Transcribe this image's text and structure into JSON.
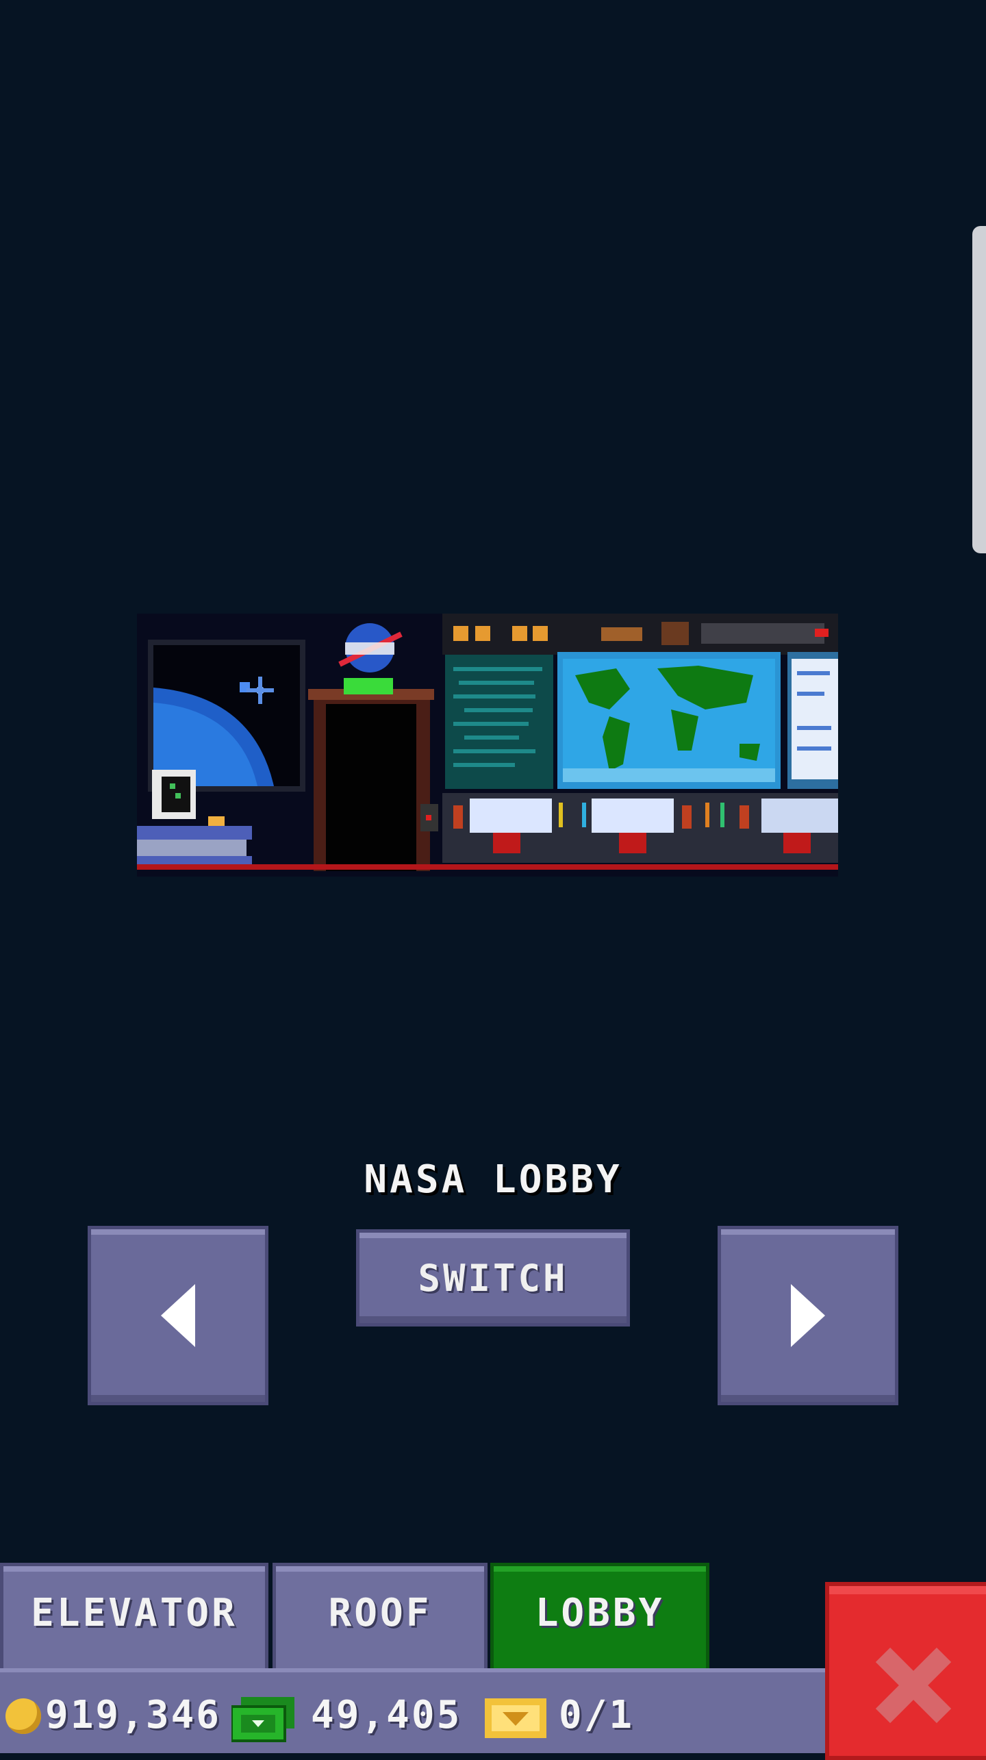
{
  "lobby": {
    "name": "NASA LOBBY",
    "switch_label": "SWITCH"
  },
  "tabs": [
    {
      "label": "ELEVATOR"
    },
    {
      "label": "ROOF"
    },
    {
      "label": "LOBBY",
      "active": true
    }
  ],
  "currency": {
    "coins": "919,346",
    "bux": "49,405",
    "tickets": "0/1"
  },
  "colors": {
    "background": "#061423",
    "button": "#6a6a9a",
    "active_tab": "#0e7d12",
    "close": "#e42b2e"
  },
  "icons": {
    "prev": "chevron-left-icon",
    "next": "chevron-right-icon",
    "close": "close-icon",
    "coin": "coin-icon",
    "cash": "cash-icon",
    "ticket": "ticket-icon"
  }
}
